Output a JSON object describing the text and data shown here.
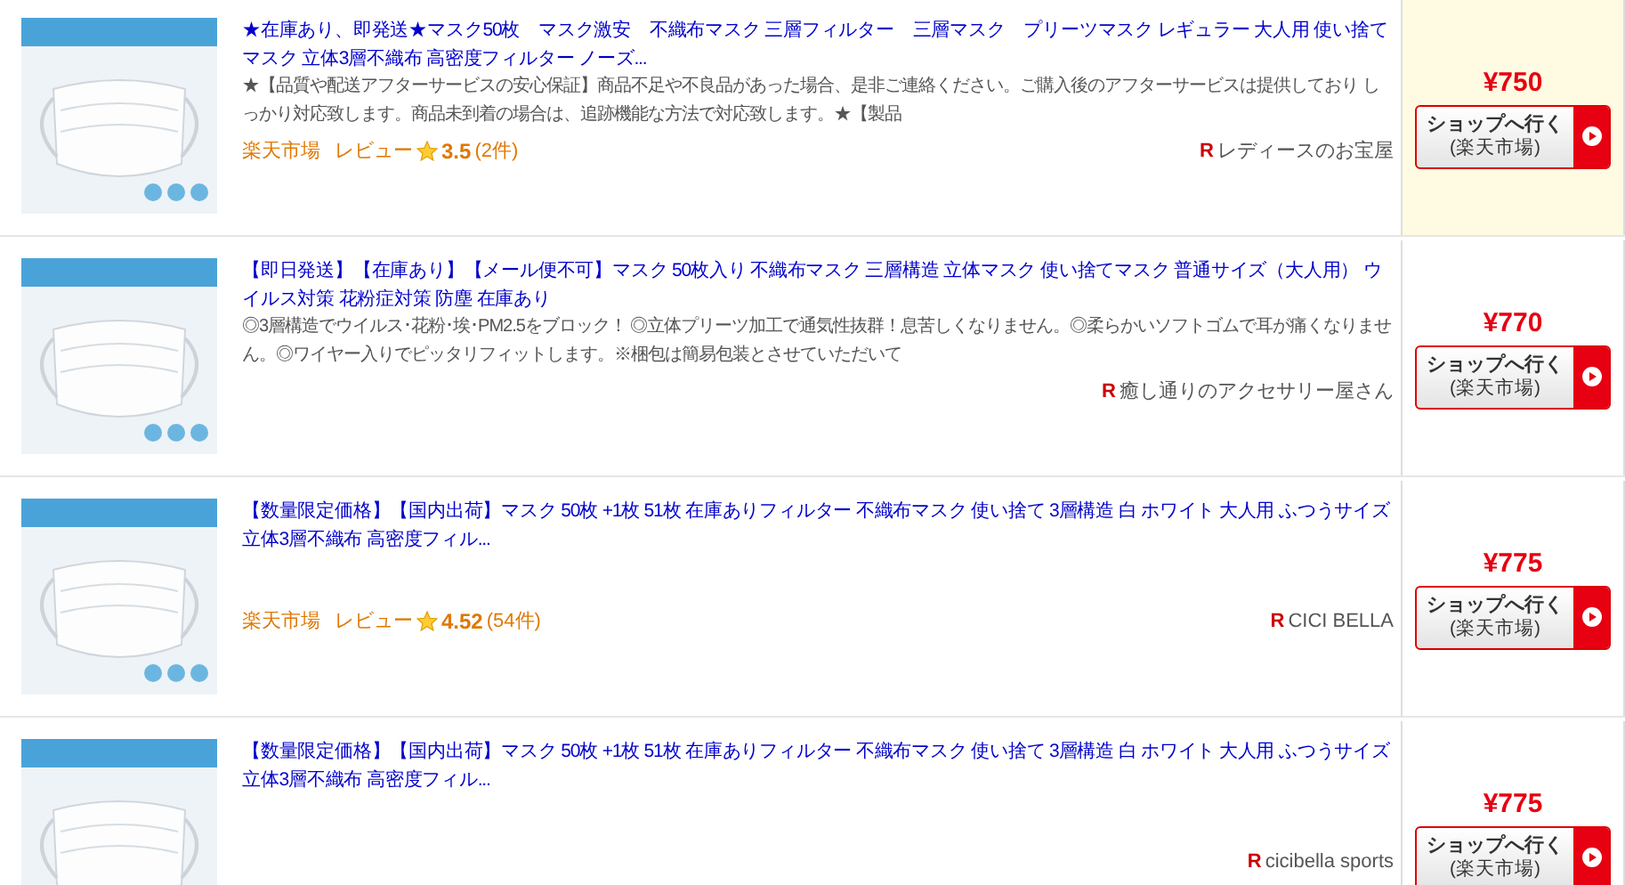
{
  "items": [
    {
      "highlighted": true,
      "title": "★在庫あり、即発送★マスク50枚　マスク激安　不織布マスク 三層フィルター　三層マスク　プリーツマスク レギュラー 大人用 使い捨てマスク 立体3層不織布 高密度フィルター ノーズ...",
      "description": "★【品質や配送アフターサービスの安心保証】商品不足や不良品があった場合、是非ご連絡ください。ご購入後のアフターサービスは提供しており しっかり対応致します。商品未到着の場合は、追跡機能な方法で対応致します。★【製品",
      "market": "楽天市場",
      "review_label": "レビュー",
      "rating": "3.5",
      "review_count": "(2件)",
      "shop_mark": "R",
      "shop": "レディースのお宝屋",
      "price": "¥750",
      "button_label": "ショップへ行く",
      "button_sublabel": "(楽天市場)"
    },
    {
      "highlighted": false,
      "title": "【即日発送】【在庫あり】【メール便不可】マスク 50枚入り 不織布マスク 三層構造 立体マスク 使い捨てマスク 普通サイズ（大人用） ウイルス対策 花粉症対策 防塵 在庫あり",
      "description": "◎3層構造でウイルス･花粉･埃･PM2.5をブロック！ ◎立体プリーツ加工で通気性抜群！息苦しくなりません。◎柔らかいソフトゴムで耳が痛くなりません。◎ワイヤー入りでピッタリフィットします。※梱包は簡易包装とさせていただいて",
      "shop_mark": "R",
      "shop": "癒し通りのアクセサリー屋さん",
      "price": "¥770",
      "button_label": "ショップへ行く",
      "button_sublabel": "(楽天市場)"
    },
    {
      "highlighted": false,
      "title": "【数量限定価格】【国内出荷】マスク 50枚 +1枚 51枚 在庫ありフィルター 不織布マスク 使い捨て 3層構造 白 ホワイト 大人用 ふつうサイズ立体3層不織布 高密度フィル...",
      "market": "楽天市場",
      "review_label": "レビュー",
      "rating": "4.52",
      "review_count": "(54件)",
      "shop_mark": "R",
      "shop": "CICI BELLA",
      "price": "¥775",
      "button_label": "ショップへ行く",
      "button_sublabel": "(楽天市場)"
    },
    {
      "highlighted": false,
      "title": "【数量限定価格】【国内出荷】マスク 50枚 +1枚 51枚 在庫ありフィルター 不織布マスク 使い捨て 3層構造 白 ホワイト 大人用 ふつうサイズ立体3層不織布 高密度フィル...",
      "shop_mark": "R",
      "shop": "cicibella sports",
      "price": "¥775",
      "button_label": "ショップへ行く",
      "button_sublabel": "(楽天市場)"
    }
  ]
}
